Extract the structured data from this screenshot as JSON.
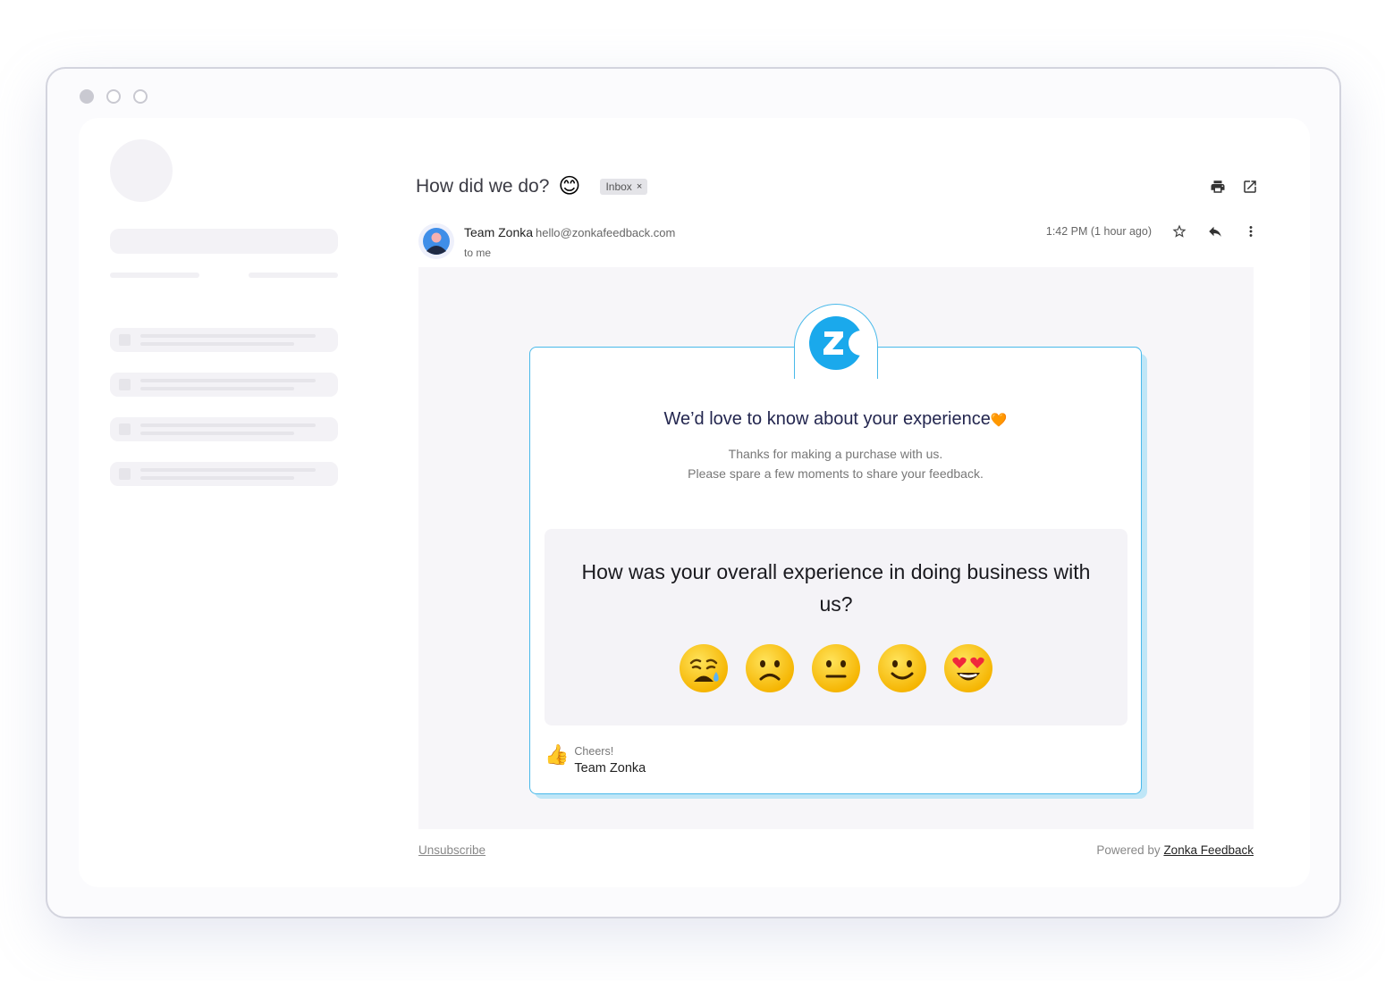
{
  "email": {
    "subject": "How did we do?",
    "subject_emoji": "😊",
    "label": "Inbox",
    "label_close": "×",
    "sender_name": "Team Zonka",
    "sender_email": "hello@zonkafeedback.com",
    "recipient": "to me",
    "timestamp": "1:42 PM (1 hour ago)"
  },
  "card": {
    "title": "We’d love to know about your experience",
    "title_emoji": "🧡",
    "subtitle_line1": "Thanks for making a purchase with us.",
    "subtitle_line2": "Please spare a few moments to share your feedback.",
    "question": "How was your overall experience in doing business with us?",
    "ratings": [
      "very-bad",
      "bad",
      "neutral",
      "good",
      "excellent"
    ],
    "signoff_emoji": "👍",
    "signoff_greeting": "Cheers!",
    "signoff_name": "Team Zonka"
  },
  "footer": {
    "unsubscribe": "Unsubscribe",
    "powered_by": "Powered by",
    "brand_link": "Zonka Feedback"
  },
  "colors": {
    "accent": "#49b9ea",
    "logo": "#1aa9ec",
    "emoji_yellow": "#ffcc2e"
  },
  "icons": [
    "print-icon",
    "open-in-new-icon",
    "star-icon",
    "reply-icon",
    "more-vert-icon",
    "zonka-logo-icon"
  ]
}
